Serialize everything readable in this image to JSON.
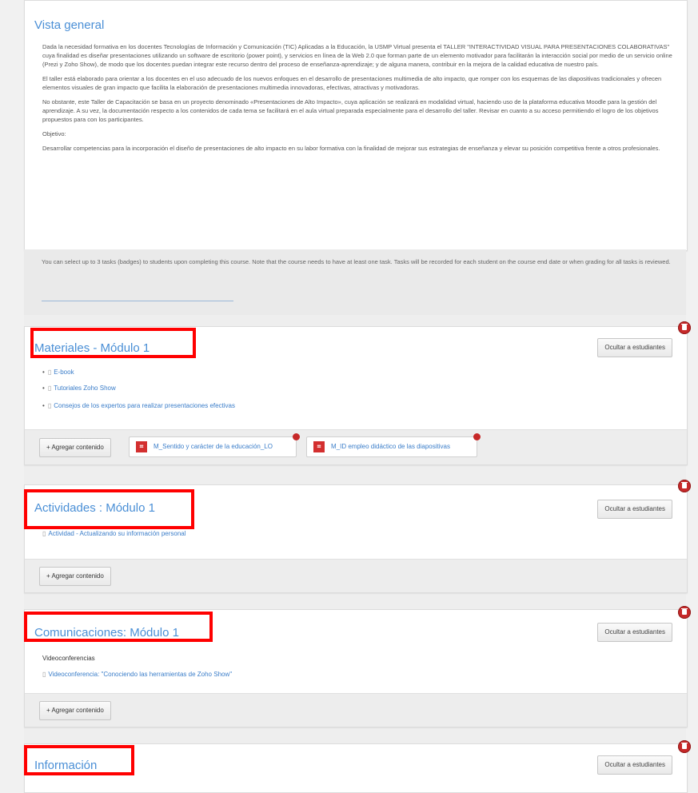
{
  "overview": {
    "title": "Vista general",
    "paragraphs": [
      "Dada la necesidad formativa en los docentes Tecnologías de Información y Comunicación (TIC) Aplicadas a la Educación, la USMP Virtual presenta el TALLER \"INTERACTIVIDAD VISUAL PARA PRESENTACIONES COLABORATIVAS\" cuya finalidad es diseñar presentaciones utilizando un software de escritorio (power point), y servicios en línea de la Web 2.0 que forman parte de un elemento motivador para facilitarán la interacción social por medio de un servicio online (Prezi y Zoho Show), de modo que los docentes puedan integrar este recurso dentro del proceso de enseñanza-aprendizaje; y de alguna manera, contribuir en la mejora de la calidad educativa de nuestro país.",
      "El taller está elaborado para orientar a los docentes en el uso adecuado de los nuevos enfoques en el desarrollo de presentaciones multimedia de alto impacto, que romper con los esquemas de las diapositivas tradicionales y ofrecen elementos visuales de gran impacto que facilita la elaboración de presentaciones multimedia innovadoras, efectivas, atractivas y motivadoras.",
      "No obstante, este Taller de Capacitación se basa en un proyecto denominado «Presentaciones de Alto Impacto», cuya aplicación se realizará en modalidad virtual, haciendo uso de la plataforma educativa Moodle para la gestión del aprendizaje. A su vez, la documentación respecto a los contenidos de cada tema se facilitará en el aula virtual preparada especialmente para el desarrollo del taller. Revisar en cuanto a su acceso permitiendo el logro de los objetivos propuestos para con los participantes.",
      "Objetivo:",
      "Desarrollar competencias para la incorporación el diseño de presentaciones de alto impacto en su labor formativa con la finalidad de mejorar sus estrategias de enseñanza y elevar su posición competitiva frente a otros profesionales."
    ],
    "badges_note": "You can select up to 3 tasks (badges) to students upon completing this course. Note that the course needs to have at least one task. Tasks will be recorded for each student on the course end date or when grading for all tasks is reviewed."
  },
  "sections": [
    {
      "title": "Materiales - Módulo 1",
      "hide_label": "Ocultar a estudiantes",
      "items": [
        "E-book",
        "Tutoriales Zoho Show",
        "Consejos de los expertos para realizar presentaciones efectivas"
      ],
      "add_label": "+ Agregar contenido",
      "attachments": [
        "M_Sentido y carácter de la educación_LO",
        "M_ID empleo didáctico de las diapositivas"
      ]
    },
    {
      "title": "Actividades : Módulo 1",
      "hide_label": "Ocultar a estudiantes",
      "items": [
        "Actividad - Actualizando su información personal"
      ],
      "add_label": "+ Agregar contenido"
    },
    {
      "title": "Comunicaciones: Módulo 1",
      "hide_label": "Ocultar a estudiantes",
      "subheading": "Videoconferencias",
      "items": [
        "Videoconferencia: \"Conociendo las herramientas de Zoho Show\""
      ],
      "add_label": "+ Agregar contenido"
    },
    {
      "title": "Información",
      "hide_label": "Ocultar a estudiantes"
    }
  ],
  "colors": {
    "accent": "#4a8fd6",
    "highlight": "#ff0000",
    "delete": "#c62828"
  },
  "icons": {
    "delete": "trash-icon",
    "doc": "document-icon",
    "pdf": "pdf-icon"
  }
}
